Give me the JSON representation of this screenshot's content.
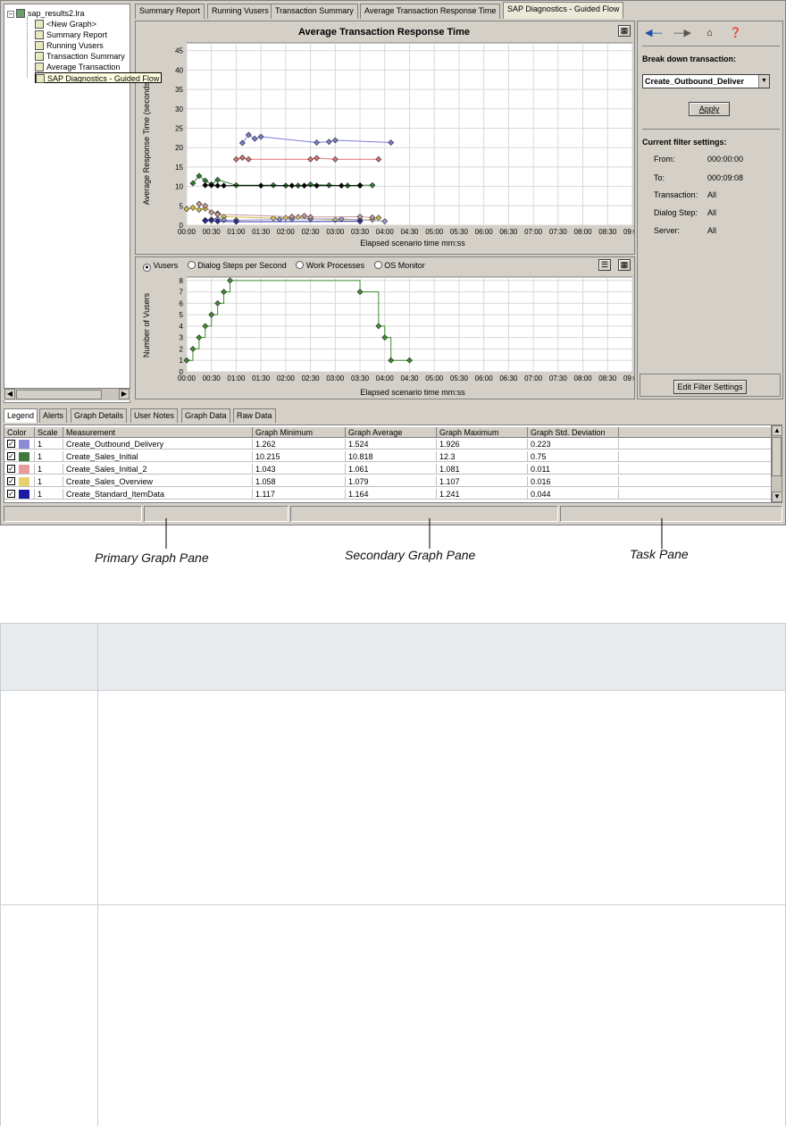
{
  "tree": {
    "root": "sap_results2.lra",
    "items": [
      "<New Graph>",
      "Summary Report",
      "Running Vusers",
      "Transaction Summary",
      "Average Transaction",
      "SAP Diagnostics - Guided Flow"
    ]
  },
  "tabs": [
    "Summary Report",
    "Running Vusers",
    "Transaction Summary",
    "Average Transaction Response Time",
    "SAP Diagnostics - Guided Flow"
  ],
  "primary": {
    "title": "Average Transaction Response Time",
    "ylabel": "Average Response Time (seconds)",
    "xlabel": "Elapsed scenario time mm:ss"
  },
  "secondary": {
    "radio_vusers": "Vusers",
    "radio_dialog": "Dialog Steps per Second",
    "radio_work": "Work Processes",
    "radio_os": "OS Monitor",
    "ylabel": "Number of Vusers",
    "xlabel": "Elapsed scenario time mm:ss"
  },
  "chart_data": [
    {
      "type": "line",
      "title": "Average Transaction Response Time",
      "xlabel": "Elapsed scenario time mm:ss",
      "ylabel": "Average Response Time (seconds)",
      "x_ticks": [
        "00:00",
        "00:30",
        "01:00",
        "01:30",
        "02:00",
        "02:30",
        "03:00",
        "03:30",
        "04:00",
        "04:30",
        "05:00",
        "05:30",
        "06:00",
        "06:30",
        "07:00",
        "07:30",
        "08:00",
        "08:30",
        "09:00"
      ],
      "y_ticks": [
        0,
        5,
        10,
        15,
        20,
        25,
        30,
        35,
        40,
        45
      ],
      "ylim": [
        0,
        47
      ],
      "grid": true,
      "series": [
        {
          "color": "#7b7bd6",
          "points": [
            [
              2.25,
              21.2
            ],
            [
              2.5,
              23.3
            ],
            [
              2.75,
              22.3
            ],
            [
              3.0,
              22.8
            ],
            [
              5.25,
              21.3
            ],
            [
              5.75,
              21.5
            ],
            [
              6.0,
              21.9
            ],
            [
              8.25,
              21.3
            ]
          ]
        },
        {
          "color": "#e07070",
          "points": [
            [
              2.0,
              17.0
            ],
            [
              2.25,
              17.4
            ],
            [
              2.5,
              17.0
            ],
            [
              5.0,
              17.0
            ],
            [
              5.25,
              17.3
            ],
            [
              6.0,
              17.0
            ],
            [
              7.75,
              17.0
            ]
          ]
        },
        {
          "color": "#2e7d32",
          "points": [
            [
              0.25,
              10.8
            ],
            [
              0.5,
              12.7
            ],
            [
              0.75,
              11.5
            ],
            [
              1.0,
              10.5
            ],
            [
              1.25,
              11.7
            ],
            [
              2.0,
              10.3
            ],
            [
              3.5,
              10.3
            ],
            [
              4.0,
              10.2
            ],
            [
              4.5,
              10.2
            ],
            [
              5.0,
              10.5
            ],
            [
              5.75,
              10.3
            ],
            [
              6.5,
              10.2
            ],
            [
              7.0,
              10.3
            ],
            [
              7.5,
              10.3
            ]
          ]
        },
        {
          "color": "#000000",
          "points": [
            [
              0.75,
              10.3
            ],
            [
              1.0,
              10.3
            ],
            [
              1.25,
              10.2
            ],
            [
              1.5,
              10.2
            ],
            [
              3.0,
              10.2
            ],
            [
              4.25,
              10.2
            ],
            [
              4.75,
              10.2
            ],
            [
              5.25,
              10.2
            ],
            [
              6.25,
              10.2
            ],
            [
              7.0,
              10.2
            ]
          ]
        },
        {
          "color": "#d4c04a",
          "points": [
            [
              0.0,
              4.2
            ],
            [
              0.25,
              4.5
            ],
            [
              0.5,
              4.0
            ],
            [
              0.75,
              4.3
            ],
            [
              1.25,
              3.0
            ],
            [
              1.5,
              2.2
            ],
            [
              3.5,
              1.8
            ],
            [
              4.0,
              1.9
            ],
            [
              4.5,
              2.1
            ],
            [
              5.0,
              1.6
            ],
            [
              6.0,
              1.4
            ],
            [
              7.5,
              1.4
            ],
            [
              7.75,
              1.9
            ]
          ]
        },
        {
          "color": "#9a9ad0",
          "points": [
            [
              0.75,
              1.3
            ],
            [
              1.0,
              1.5
            ],
            [
              1.25,
              1.6
            ],
            [
              1.5,
              1.3
            ],
            [
              2.0,
              1.3
            ],
            [
              3.75,
              1.5
            ],
            [
              4.25,
              1.6
            ],
            [
              5.0,
              1.6
            ],
            [
              6.25,
              1.6
            ],
            [
              7.0,
              1.4
            ],
            [
              8.0,
              1.0
            ]
          ]
        },
        {
          "color": "#c79a9a",
          "points": [
            [
              0.5,
              5.5
            ],
            [
              0.75,
              5.0
            ],
            [
              1.0,
              3.3
            ],
            [
              1.25,
              2.8
            ],
            [
              4.25,
              2.2
            ],
            [
              4.75,
              2.4
            ],
            [
              5.0,
              2.1
            ],
            [
              7.0,
              2.2
            ],
            [
              7.5,
              2.0
            ]
          ]
        },
        {
          "color": "#2a2aa0",
          "points": [
            [
              0.75,
              1.1
            ],
            [
              1.0,
              1.2
            ],
            [
              1.25,
              1.0
            ],
            [
              2.0,
              0.9
            ],
            [
              7.0,
              1.0
            ]
          ]
        }
      ]
    },
    {
      "type": "line",
      "xlabel": "Elapsed scenario time mm:ss",
      "ylabel": "Number of Vusers",
      "x_ticks": [
        "00:00",
        "00:30",
        "01:00",
        "01:30",
        "02:00",
        "02:30",
        "03:00",
        "03:30",
        "04:00",
        "04:30",
        "05:00",
        "05:30",
        "06:00",
        "06:30",
        "07:00",
        "07:30",
        "08:00",
        "08:30",
        "09:00"
      ],
      "y_ticks": [
        0,
        1,
        2,
        3,
        4,
        5,
        6,
        7,
        8
      ],
      "ylim": [
        0,
        8.3
      ],
      "grid": true,
      "series": [
        {
          "name": "Vusers",
          "color": "#3e8e2e",
          "points": [
            [
              0.0,
              1
            ],
            [
              0.25,
              2
            ],
            [
              0.5,
              3
            ],
            [
              0.75,
              4
            ],
            [
              1.0,
              5
            ],
            [
              1.25,
              6
            ],
            [
              1.5,
              7
            ],
            [
              1.75,
              8
            ],
            [
              7.0,
              7
            ],
            [
              7.75,
              4
            ],
            [
              8.0,
              3
            ],
            [
              8.25,
              1
            ],
            [
              9.0,
              1
            ]
          ]
        }
      ]
    }
  ],
  "task": {
    "breakdown_label": "Break down transaction:",
    "breakdown_value": "Create_Outbound_Deliver",
    "apply": "Apply",
    "filter_title": "Current filter settings:",
    "filters": [
      {
        "k": "From:",
        "v": "000:00:00"
      },
      {
        "k": "To:",
        "v": "000:09:08"
      },
      {
        "k": "Transaction:",
        "v": "All"
      },
      {
        "k": "Dialog Step:",
        "v": "All"
      },
      {
        "k": "Server:",
        "v": "All"
      }
    ],
    "edit": "Edit Filter Settings"
  },
  "bottom_tabs": [
    "Legend",
    "Alerts",
    "Graph Details",
    "User Notes",
    "Graph Data",
    "Raw Data"
  ],
  "legend": {
    "headers": [
      "Color",
      "Scale",
      "Measurement",
      "Graph Minimum",
      "Graph Average",
      "Graph Maximum",
      "Graph Std. Deviation"
    ],
    "rows": [
      {
        "color": "#8b8bd8",
        "scale": "1",
        "measurement": "Create_Outbound_Delivery",
        "min": "1.262",
        "avg": "1.524",
        "max": "1.926",
        "std": "0.223"
      },
      {
        "color": "#3e7a3e",
        "scale": "1",
        "measurement": "Create_Sales_Initial",
        "min": "10.215",
        "avg": "10.818",
        "max": "12.3",
        "std": "0.75"
      },
      {
        "color": "#e89a9a",
        "scale": "1",
        "measurement": "Create_Sales_Initial_2",
        "min": "1.043",
        "avg": "1.061",
        "max": "1.081",
        "std": "0.011"
      },
      {
        "color": "#e8d070",
        "scale": "1",
        "measurement": "Create_Sales_Overview",
        "min": "1.058",
        "avg": "1.079",
        "max": "1.107",
        "std": "0.016"
      },
      {
        "color": "#1a1aa0",
        "scale": "1",
        "measurement": "Create_Standard_ItemData",
        "min": "1.117",
        "avg": "1.164",
        "max": "1.241",
        "std": "0.044"
      }
    ]
  },
  "callouts": [
    "Primary Graph Pane",
    "Secondary Graph Pane",
    "Task Pane"
  ]
}
